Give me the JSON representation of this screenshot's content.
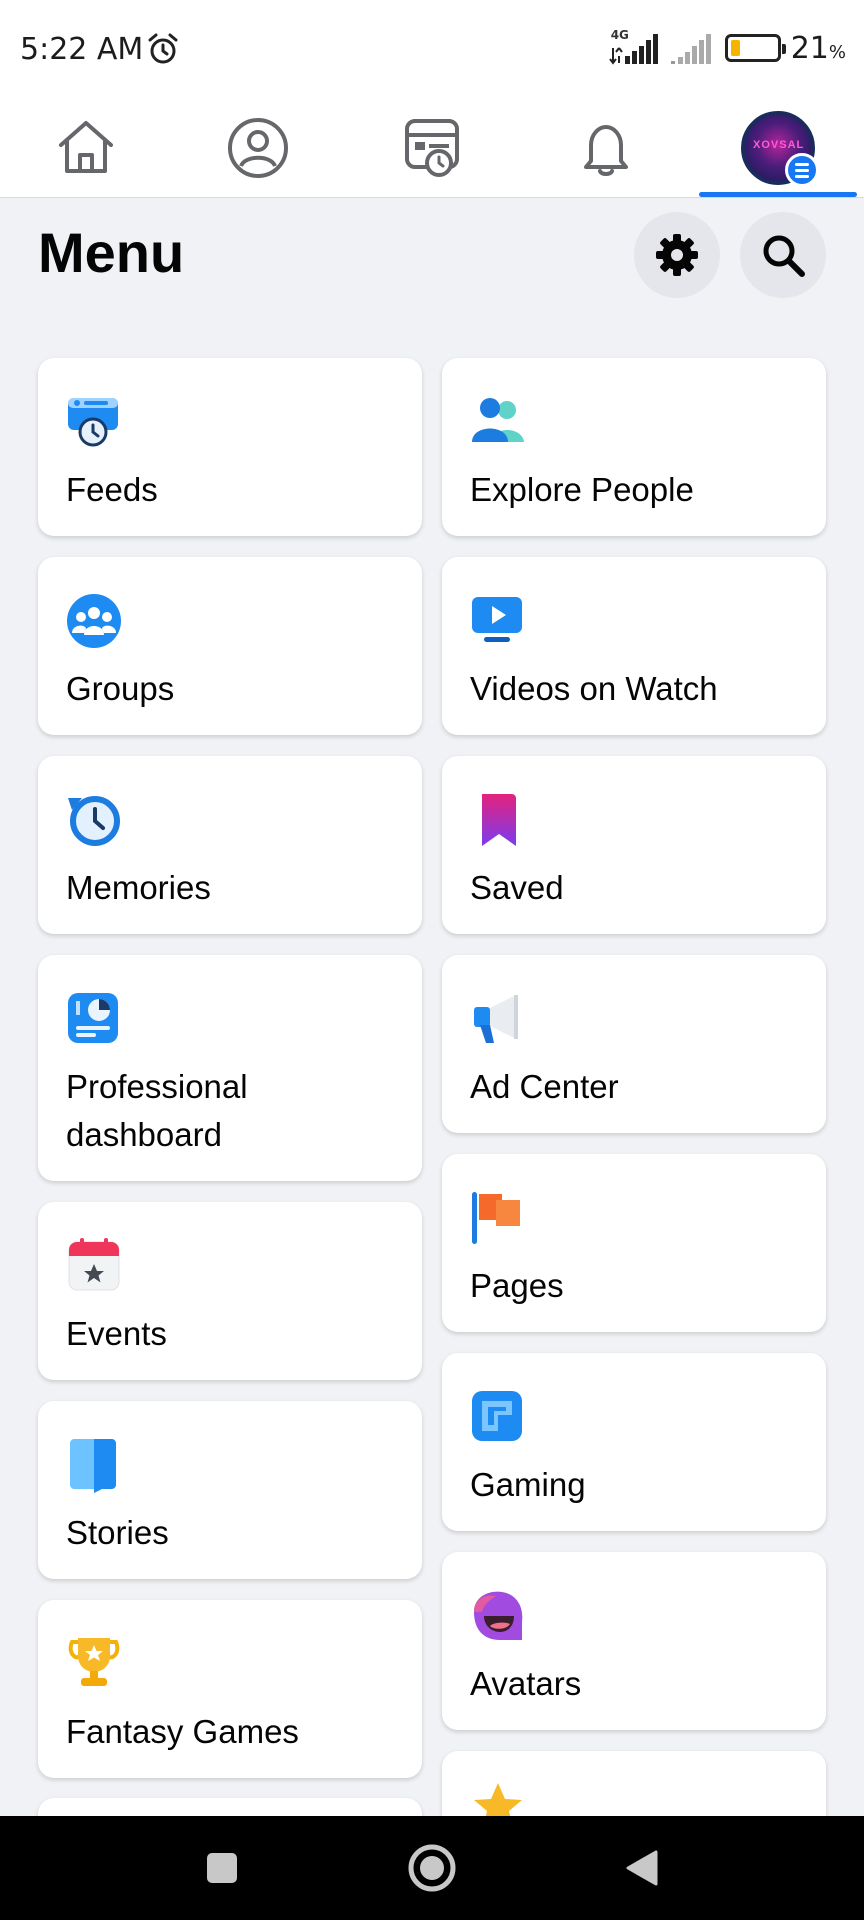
{
  "status_bar": {
    "time": "5:22 AM",
    "network": "4G",
    "battery_percent": "21",
    "battery_unit": "%",
    "battery_level": 0.21
  },
  "tabs": [
    {
      "icon": "home-icon"
    },
    {
      "icon": "profile-icon"
    },
    {
      "icon": "feeds-icon"
    },
    {
      "icon": "bell-icon"
    },
    {
      "icon": "avatar-menu-icon",
      "active": true
    }
  ],
  "avatar_text": "XOVSAL",
  "header": {
    "title": "Menu",
    "settings_icon": "gear-icon",
    "search_icon": "search-icon"
  },
  "left_items": [
    {
      "label": "Feeds",
      "icon": "feeds-icon"
    },
    {
      "label": "Groups",
      "icon": "groups-icon"
    },
    {
      "label": "Memories",
      "icon": "memories-icon"
    },
    {
      "label": "Professional dashboard",
      "icon": "dashboard-icon"
    },
    {
      "label": "Events",
      "icon": "events-icon"
    },
    {
      "label": "Stories",
      "icon": "stories-icon"
    },
    {
      "label": "Fantasy Games",
      "icon": "trophy-icon"
    }
  ],
  "right_items": [
    {
      "label": "Explore People",
      "icon": "people-icon"
    },
    {
      "label": "Videos on Watch",
      "icon": "video-icon"
    },
    {
      "label": "Saved",
      "icon": "bookmark-icon"
    },
    {
      "label": "Ad Center",
      "icon": "megaphone-icon"
    },
    {
      "label": "Pages",
      "icon": "flag-icon"
    },
    {
      "label": "Gaming",
      "icon": "gaming-icon"
    },
    {
      "label": "Avatars",
      "icon": "avatar-face-icon"
    }
  ],
  "colors": {
    "accent": "#1877f2",
    "background": "#f0f2f5",
    "card": "#ffffff"
  }
}
